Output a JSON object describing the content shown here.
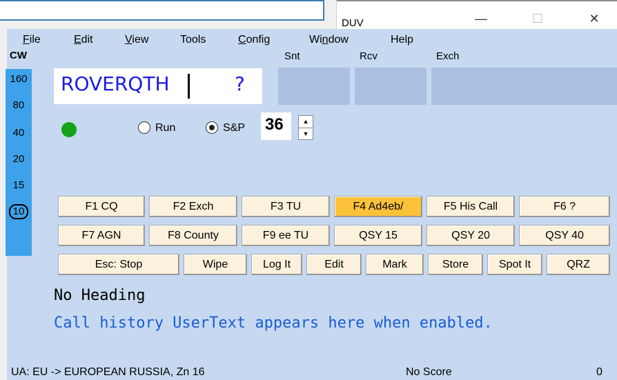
{
  "title_bar": {
    "title": "DUV",
    "minimize": "—",
    "maximize": "☐",
    "close": "✕"
  },
  "menu": [
    {
      "label": "File",
      "mnemonic": "F",
      "rest": "ile"
    },
    {
      "label": "Edit",
      "mnemonic": "E",
      "rest": "dit"
    },
    {
      "label": "View",
      "mnemonic": "V",
      "rest": "iew"
    },
    {
      "label": "Tools",
      "mnemonic": "",
      "rest": "Tools"
    },
    {
      "label": "Config",
      "mnemonic": "C",
      "rest": "onfig"
    },
    {
      "label": "Window",
      "pre": "Wi",
      "mnemonic": "n",
      "rest": "dow"
    },
    {
      "label": "Help",
      "mnemonic": "",
      "rest": "Help"
    }
  ],
  "mode": "CW",
  "bands": [
    "160",
    "80",
    "40",
    "20",
    "15",
    "10"
  ],
  "active_band": "10",
  "columns": {
    "snt": "Snt",
    "rcv": "Rcv",
    "exch": "Exch"
  },
  "call_entry": {
    "value": "ROVERQTH",
    "flag": "?"
  },
  "run_label": "Run",
  "sp_label": "S&P",
  "sp_selected": true,
  "speed": "36",
  "function_keys": {
    "row1": [
      "F1 CQ",
      "F2 Exch",
      "F3 TU",
      "F4 Ad4eb/",
      "F5 His Call",
      "F6 ?"
    ],
    "row2": [
      "F7 AGN",
      "F8 County",
      "F9 ee TU",
      "QSY 15",
      "QSY 20",
      "QSY 40"
    ],
    "row3": [
      "Esc: Stop",
      "Wipe",
      "Log It",
      "Edit",
      "Mark",
      "Store",
      "Spot It",
      "QRZ"
    ]
  },
  "heading": "No Heading",
  "user_text": "Call history UserText appears here when enabled.",
  "status": {
    "left": "UA: EU -> EUROPEAN RUSSIA, Zn 16",
    "center": "No Score",
    "right": "0"
  },
  "colors": {
    "client_bg": "#c6d9f0",
    "band_bar": "#3ea2ea",
    "call_text": "#1a1ae6",
    "led": "#16a317",
    "fkey_bg": "#fcf1dc",
    "fkey_highlight": "#fcc23a",
    "usertext": "#1a5cd6"
  }
}
